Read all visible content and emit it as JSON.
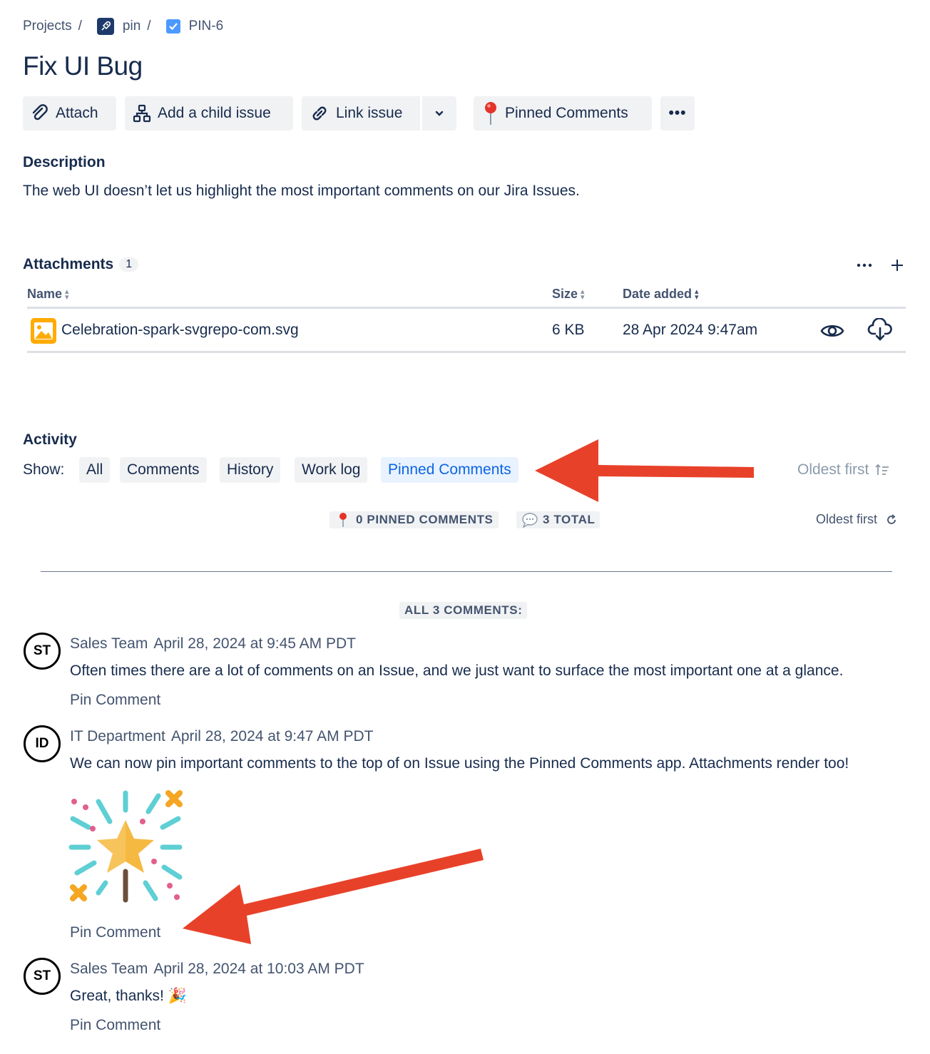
{
  "breadcrumb": {
    "projects": "Projects",
    "project": "pin",
    "issue": "PIN-6",
    "sep": "/"
  },
  "issue": {
    "title": "Fix UI Bug"
  },
  "toolbar": {
    "attach": "Attach",
    "add_child": "Add a child issue",
    "link_issue": "Link issue",
    "pinned_comments": "Pinned Comments",
    "more": "•••"
  },
  "description": {
    "label": "Description",
    "text": "The web UI doesn’t let us highlight the most important comments on our Jira Issues."
  },
  "attachments": {
    "label": "Attachments",
    "count": "1",
    "columns": {
      "name": "Name",
      "size": "Size",
      "date": "Date added"
    },
    "rows": [
      {
        "name": "Celebration-spark-svgrepo-com.svg",
        "size": "6 KB",
        "date": "28 Apr 2024 9:47am"
      }
    ]
  },
  "activity": {
    "label": "Activity",
    "show_label": "Show:",
    "filters": [
      "All",
      "Comments",
      "History",
      "Work log",
      "Pinned Comments"
    ],
    "active_filter": "Pinned Comments",
    "sort_disabled": "Oldest first",
    "pinned_count": "0 PINNED COMMENTS",
    "total_count": "3 TOTAL",
    "sort": "Oldest first",
    "all_comments_label": "ALL 3 COMMENTS:"
  },
  "comments": [
    {
      "initials": "ST",
      "author": "Sales Team",
      "date": "April 28, 2024 at 9:45 AM PDT",
      "text": "Often times there are a lot of comments on an Issue, and we just want to surface the most important one at a glance.",
      "action": "Pin Comment"
    },
    {
      "initials": "ID",
      "author": "IT Department",
      "date": "April 28, 2024 at 9:47 AM PDT",
      "text": "We can now pin important comments to the top of on Issue using the Pinned Comments app. Attachments render too!",
      "action": "Pin Comment"
    },
    {
      "initials": "ST",
      "author": "Sales Team",
      "date": "April 28, 2024 at 10:03 AM PDT",
      "text": "Great, thanks! 🎉",
      "action": "Pin Comment"
    }
  ],
  "colors": {
    "accent": "#0c66e4",
    "arrow": "#e8412a",
    "text": "#172b4d",
    "subtle": "#44546f"
  }
}
